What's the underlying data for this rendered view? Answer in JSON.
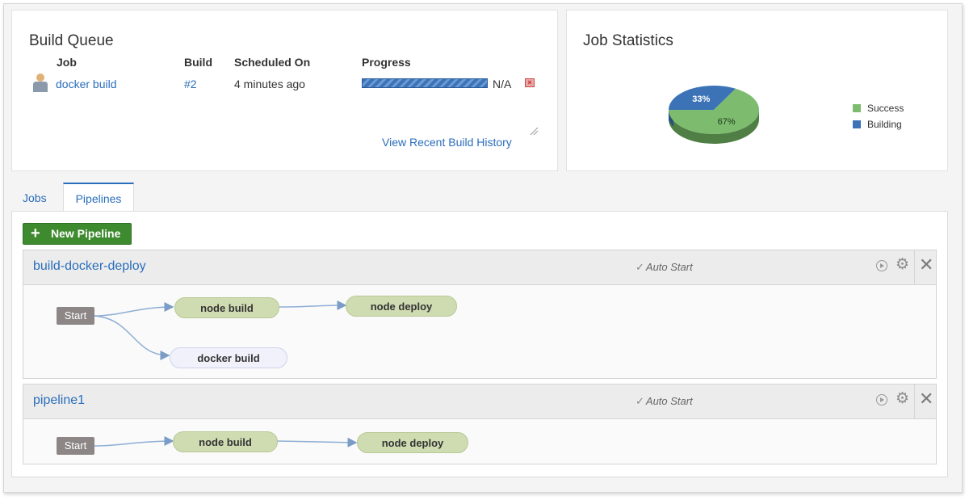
{
  "build_queue": {
    "title": "Build Queue",
    "columns": {
      "job": "Job",
      "build": "Build",
      "scheduled": "Scheduled On",
      "progress": "Progress"
    },
    "row": {
      "job": "docker build",
      "build": "#2",
      "scheduled": "4 minutes ago",
      "progress_text": "N/A",
      "progress_fraction": 1.0
    },
    "history_link": "View Recent Build History"
  },
  "job_statistics": {
    "title": "Job Statistics",
    "legend": [
      {
        "label": "Success",
        "color": "#7dbb6e"
      },
      {
        "label": "Building",
        "color": "#3b73b6"
      }
    ]
  },
  "chart_data": {
    "type": "pie",
    "title": "",
    "slices": [
      {
        "label": "Success",
        "value": 67,
        "text": "67%",
        "color": "#7dbb6e"
      },
      {
        "label": "Building",
        "value": 33,
        "text": "33%",
        "color": "#3b73b6"
      }
    ],
    "legend_position": "right"
  },
  "tabs": [
    {
      "label": "Jobs",
      "active": false
    },
    {
      "label": "Pipelines",
      "active": true
    }
  ],
  "new_pipeline_label": "New Pipeline",
  "pipelines": [
    {
      "name": "build-docker-deploy",
      "auto_start": "Auto Start",
      "start_label": "Start",
      "nodes": [
        "node build",
        "node deploy",
        "docker build"
      ]
    },
    {
      "name": "pipeline1",
      "auto_start": "Auto Start",
      "start_label": "Start",
      "nodes": [
        "node build",
        "node deploy"
      ]
    }
  ],
  "icons": {
    "user": "user-icon",
    "cancel": "cancel-icon",
    "play": "play-circle-icon",
    "gear": "gear-icon",
    "close": "close-icon",
    "plus": "plus-icon",
    "check": "checkmark-icon"
  }
}
